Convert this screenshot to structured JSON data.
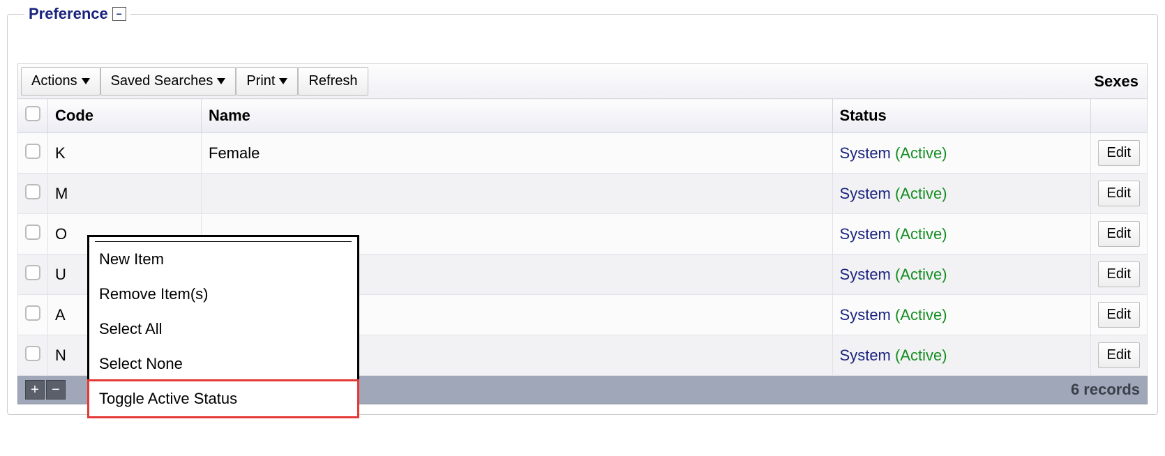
{
  "panel": {
    "title": "Preference",
    "collapse_glyph": "−"
  },
  "toolbar": {
    "actions_label": "Actions",
    "saved_searches_label": "Saved Searches",
    "print_label": "Print",
    "refresh_label": "Refresh",
    "right_label": "Sexes"
  },
  "columns": {
    "code": "Code",
    "name": "Name",
    "status": "Status"
  },
  "status_text": {
    "system": "System",
    "active": "(Active)"
  },
  "edit_label": "Edit",
  "rows": [
    {
      "code": "K",
      "name": "Female"
    },
    {
      "code": "M",
      "name": ""
    },
    {
      "code": "O",
      "name": ""
    },
    {
      "code": "U",
      "name": ""
    },
    {
      "code": "A",
      "name": ""
    },
    {
      "code": "N",
      "name": ""
    }
  ],
  "footer": {
    "add_glyph": "+",
    "remove_glyph": "−",
    "records_label": "6 records"
  },
  "context_menu": {
    "items": [
      "New Item",
      "Remove Item(s)",
      "Select All",
      "Select None",
      "Toggle Active Status"
    ],
    "highlight_index": 4
  }
}
